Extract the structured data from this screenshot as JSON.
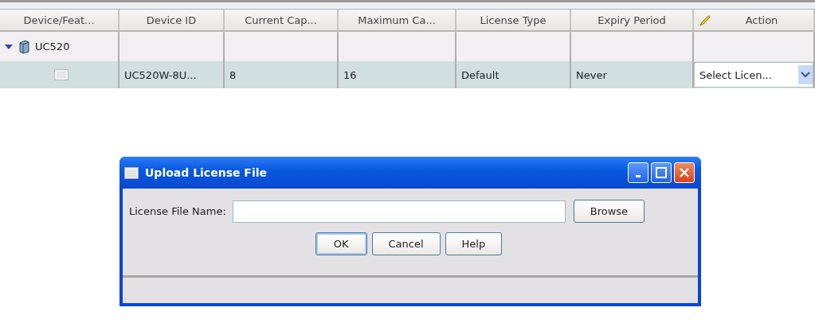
{
  "table": {
    "columns": [
      {
        "label": "Device/Feat..."
      },
      {
        "label": "Device ID"
      },
      {
        "label": "Current Cap..."
      },
      {
        "label": "Maximum Ca..."
      },
      {
        "label": "License Type"
      },
      {
        "label": "Expiry Period"
      },
      {
        "label": "Action"
      }
    ],
    "rows": [
      {
        "label": "UC520",
        "expanded": true,
        "selected": false,
        "children": [
          {
            "selected": true,
            "cells": [
              "UC520W-8U...",
              "8",
              "16",
              "Default",
              "Never"
            ],
            "action": {
              "placeholder": "Select Licen..."
            }
          }
        ]
      }
    ]
  },
  "dialog": {
    "title": "Upload License File",
    "field_label": "License File Name:",
    "browse": "Browse",
    "buttons": [
      "OK",
      "Cancel",
      "Help"
    ]
  }
}
